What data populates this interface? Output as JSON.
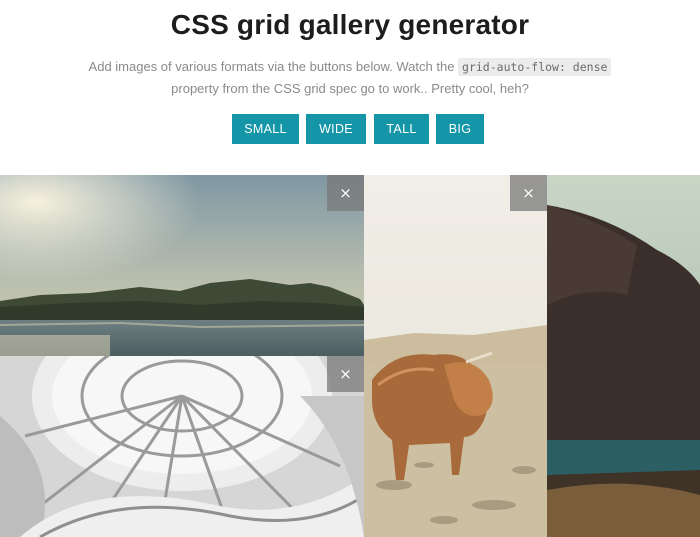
{
  "header": {
    "title": "CSS grid gallery generator",
    "desc_before": "Add images of various formats via the buttons below. Watch the ",
    "code": "grid-auto-flow: dense",
    "desc_after": "property from the CSS grid spec go to work.. Pretty cool, heh?"
  },
  "buttons": {
    "small": "SMALL",
    "wide": "WIDE",
    "tall": "TALL",
    "big": "BIG"
  },
  "colors": {
    "accent": "#1496a8"
  },
  "gallery": {
    "close_glyph": "×",
    "tiles": [
      {
        "name": "landscape-lake-photo",
        "format": "wide"
      },
      {
        "name": "dome-interior-photo",
        "format": "wide"
      },
      {
        "name": "highland-cow-photo",
        "format": "tall"
      },
      {
        "name": "mountain-lake-photo",
        "format": "tall"
      }
    ]
  }
}
